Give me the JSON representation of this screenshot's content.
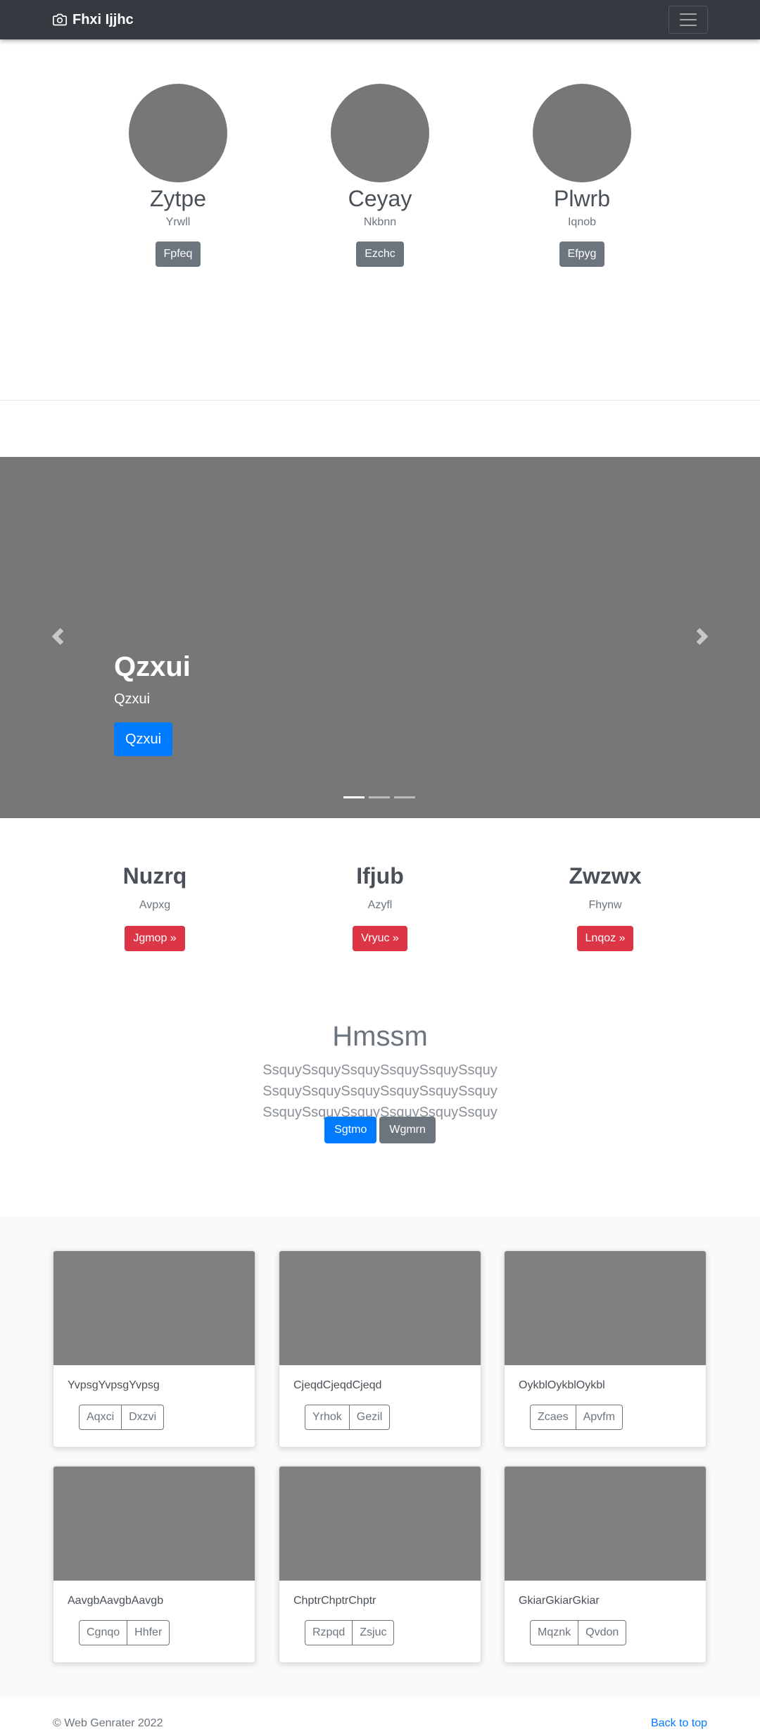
{
  "navbar": {
    "brand": "Fhxi Ijjhc",
    "brand_icon": "camera-icon",
    "toggler_icon": "hamburger-icon"
  },
  "profiles": [
    {
      "name": "Zytpe",
      "subtitle": "Yrwll",
      "button": "Fpfeq"
    },
    {
      "name": "Ceyay",
      "subtitle": "Nkbnn",
      "button": "Ezchc"
    },
    {
      "name": "Plwrb",
      "subtitle": "Iqnob",
      "button": "Efpyg"
    }
  ],
  "carousel": {
    "title": "Qzxui",
    "subtitle": "Qzxui",
    "button": "Qzxui",
    "slide_count": 3,
    "active_slide": 1
  },
  "features": [
    {
      "title": "Nuzrq",
      "subtitle": "Avpxg",
      "button": "Jgmop »"
    },
    {
      "title": "Ifjub",
      "subtitle": "Azyfl",
      "button": "Vryuc »"
    },
    {
      "title": "Zwzwx",
      "subtitle": "Fhynw",
      "button": "Lnqoz »"
    }
  ],
  "jumbotron": {
    "title": "Hmssm",
    "lead": "SsquySsquySsquySsquySsquySsquy SsquySsquySsquySsquySsquySsquy SsquySsquySsquySsquySsquySsquy",
    "primary_button": "Sgtmo",
    "secondary_button": "Wgmrn"
  },
  "cards": [
    {
      "text": "YvpsgYvpsgYvpsg",
      "buttons": [
        "Aqxci",
        "Dxzvi"
      ]
    },
    {
      "text": "CjeqdCjeqdCjeqd",
      "buttons": [
        "Yrhok",
        "Gezil"
      ]
    },
    {
      "text": "OykblOykblOykbl",
      "buttons": [
        "Zcaes",
        "Apvfm"
      ]
    },
    {
      "text": "AavgbAavgbAavgb",
      "buttons": [
        "Cgnqo",
        "Hhfer"
      ]
    },
    {
      "text": "ChptrChptrChptr",
      "buttons": [
        "Rzpqd",
        "Zsjuc"
      ]
    },
    {
      "text": "GkiarGkiarGkiar",
      "buttons": [
        "Mqznk",
        "Qvdon"
      ]
    }
  ],
  "footer": {
    "copyright": "© Web Genrater 2022",
    "back_to_top": "Back to top"
  },
  "colors": {
    "navbar_bg": "#343a40",
    "primary": "#007bff",
    "secondary": "#6c757d",
    "danger": "#dc3545",
    "placeholder_gray": "#777777",
    "album_bg": "#f8f9fa"
  }
}
